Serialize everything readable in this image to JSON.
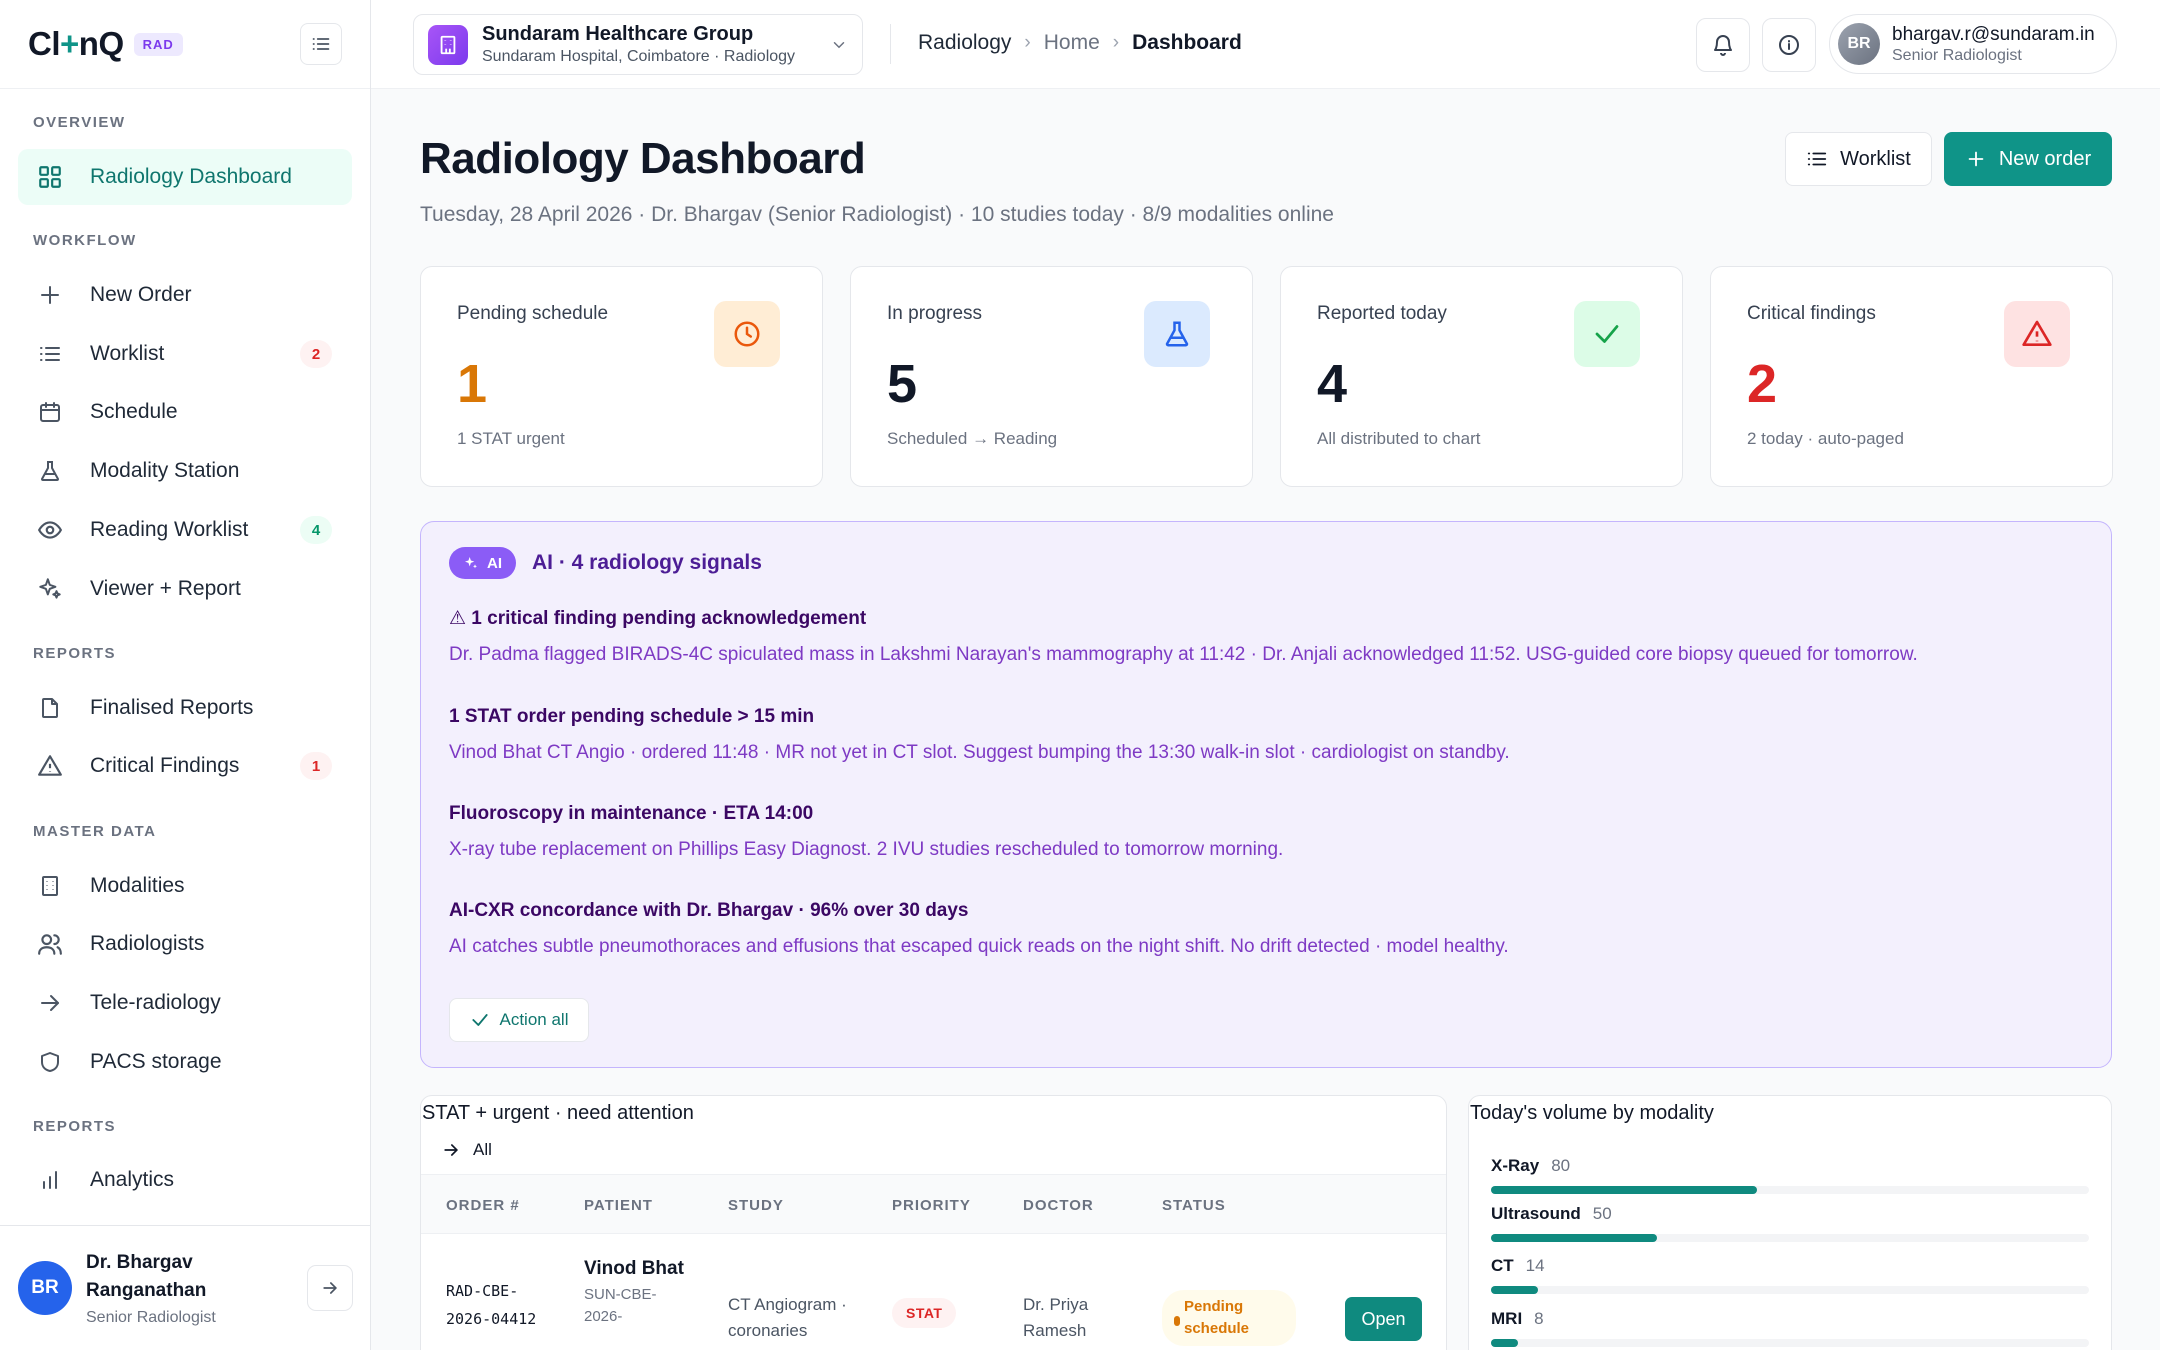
{
  "brand": {
    "logo_a": "Cl",
    "logo_plus": "+",
    "logo_b": "nQ",
    "badge": "RAD"
  },
  "sidebar": {
    "sections": [
      "OVERVIEW",
      "WORKFLOW",
      "REPORTS",
      "MASTER DATA",
      "REPORTS"
    ],
    "items": [
      {
        "label": "Radiology Dashboard",
        "icon": "grid-icon",
        "active": true
      },
      {
        "label": "New Order",
        "icon": "plus-icon"
      },
      {
        "label": "Worklist",
        "icon": "list-icon",
        "count": "2"
      },
      {
        "label": "Schedule",
        "icon": "calendar-icon"
      },
      {
        "label": "Modality Station",
        "icon": "flask-icon"
      },
      {
        "label": "Reading Worklist",
        "icon": "eye-icon",
        "count": "4"
      },
      {
        "label": "Viewer + Report",
        "icon": "sparkles-icon"
      },
      {
        "label": "Finalised Reports",
        "icon": "file-icon"
      },
      {
        "label": "Critical Findings",
        "icon": "alert-triangle-icon",
        "count": "1"
      },
      {
        "label": "Modalities",
        "icon": "building-icon"
      },
      {
        "label": "Radiologists",
        "icon": "users-icon"
      },
      {
        "label": "Tele-radiology",
        "icon": "arrow-right-icon"
      },
      {
        "label": "PACS storage",
        "icon": "shield-icon"
      },
      {
        "label": "Analytics",
        "icon": "bar-chart-icon"
      }
    ],
    "user": {
      "initials": "BR",
      "name": "Dr. Bhargav Ranganathan",
      "role": "Senior Radiologist"
    }
  },
  "topbar": {
    "org_name": "Sundaram Healthcare Group",
    "org_sub": "Sundaram Hospital, Coimbatore · Radiology",
    "breadcrumb": [
      "Radiology",
      "Home",
      "Dashboard"
    ],
    "user_initials": "BR",
    "user_email": "bhargav.r@sundaram.in",
    "user_role": "Senior Radiologist"
  },
  "header": {
    "title": "Radiology Dashboard",
    "subtitle": "Tuesday, 28 April 2026 · Dr. Bhargav (Senior Radiologist) · 10 studies today · 8/9 modalities online",
    "worklist_btn": "Worklist",
    "new_order_btn": "New order"
  },
  "stats": [
    {
      "label": "Pending schedule",
      "value": "1",
      "note": "1 STAT urgent",
      "color": "#d97706",
      "icon_bg": "#ffedd5"
    },
    {
      "label": "In progress",
      "value": "5",
      "note": "Scheduled → Reading",
      "color": "#111827",
      "icon_bg": "#dbeafe"
    },
    {
      "label": "Reported today",
      "value": "4",
      "note": "All distributed to chart",
      "color": "#111827",
      "icon_bg": "#dcfce7"
    },
    {
      "label": "Critical findings",
      "value": "2",
      "note": "2 today · auto-paged",
      "color": "#dc2626",
      "icon_bg": "#fee2e2"
    }
  ],
  "ai": {
    "badge": "AI",
    "title": "AI · 4 radiology signals",
    "signals": [
      {
        "title": "⚠ 1 critical finding pending acknowledgement",
        "body": "Dr. Padma flagged BIRADS-4C spiculated mass in Lakshmi Narayan's mammography at 11:42 · Dr. Anjali acknowledged 11:52. USG-guided core biopsy queued for tomorrow."
      },
      {
        "title": "1 STAT order pending schedule > 15 min",
        "body": "Vinod Bhat CT Angio · ordered 11:48 · MR not yet in CT slot. Suggest bumping the 13:30 walk-in slot · cardiologist on standby."
      },
      {
        "title": "Fluoroscopy in maintenance · ETA 14:00",
        "body": "X-ray tube replacement on Phillips Easy Diagnost. 2 IVU studies rescheduled to tomorrow morning."
      },
      {
        "title": "AI-CXR concordance with Dr. Bhargav · 96% over 30 days",
        "body": "AI catches subtle pneumothoraces and effusions that escaped quick reads on the night shift. No drift detected · model healthy."
      }
    ],
    "action_all": "Action all"
  },
  "stat_table": {
    "title": "STAT + urgent · need attention",
    "all_link": "All",
    "columns": [
      "ORDER #",
      "PATIENT",
      "STUDY",
      "PRIORITY",
      "DOCTOR",
      "STATUS"
    ],
    "rows": [
      {
        "order": "RAD-CBE-2026-04412",
        "patient": "Vinod Bhat",
        "patient_id": "SUN-CBE-2026-",
        "study": "CT Angiogram · coronaries",
        "priority": "STAT",
        "doctor": "Dr. Priya Ramesh",
        "status": "Pending schedule",
        "action": "Open"
      }
    ]
  },
  "volume": {
    "title": "Today's volume by modality",
    "max": 180,
    "rows": [
      {
        "label": "X-Ray",
        "value": 80
      },
      {
        "label": "Ultrasound",
        "value": 50
      },
      {
        "label": "CT",
        "value": 14
      },
      {
        "label": "MRI",
        "value": 8
      }
    ]
  }
}
